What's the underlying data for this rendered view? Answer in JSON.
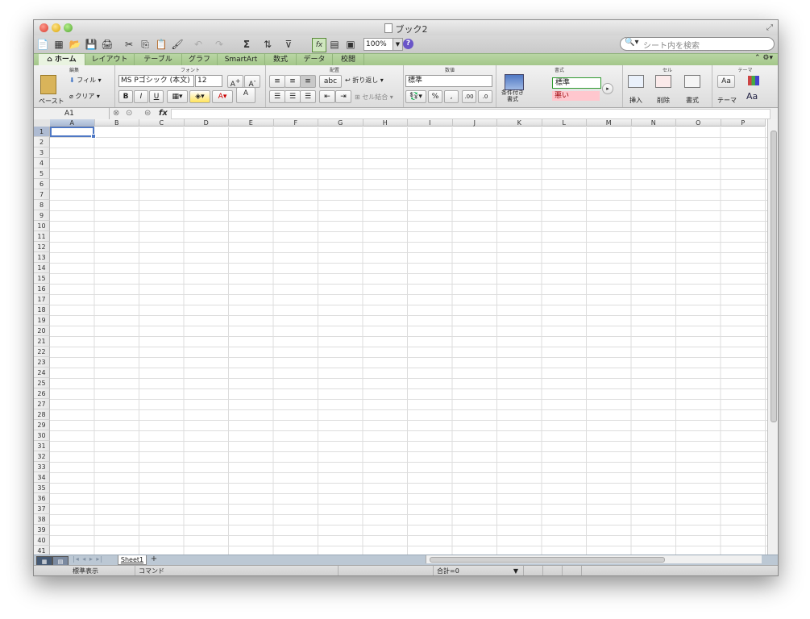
{
  "window": {
    "title": "ブック2"
  },
  "toolbar": {
    "zoom": "100%",
    "search_placeholder": "シート内を検索"
  },
  "tabs": [
    "ホーム",
    "レイアウト",
    "テーブル",
    "グラフ",
    "SmartArt",
    "数式",
    "データ",
    "校閲"
  ],
  "ribbon": {
    "groups": {
      "edit": "編集",
      "font": "フォント",
      "align": "配置",
      "number": "数値",
      "style": "書式",
      "cells": "セル",
      "theme": "テーマ"
    },
    "paste": "ペースト",
    "fill": "フィル",
    "clear": "クリア",
    "font_name": "MS Pゴシック (本文)",
    "font_size": "12",
    "bold": "B",
    "italic": "I",
    "underline": "U",
    "wrap": "折り返し",
    "merge": "セル結合",
    "abc": "abc",
    "number_format": "標準",
    "percent": "%",
    "conditional": "条件付き\n書式",
    "style_normal": "標準",
    "style_bad": "悪い",
    "insert": "挿入",
    "delete": "削除",
    "format": "書式",
    "theme": "テーマ",
    "theme_aa": "Aa"
  },
  "formula_bar": {
    "name_box": "A1",
    "fx": "fx"
  },
  "columns": [
    "A",
    "B",
    "C",
    "D",
    "E",
    "F",
    "G",
    "H",
    "I",
    "J",
    "K",
    "L",
    "M",
    "N",
    "O",
    "P"
  ],
  "rows": [
    "1",
    "2",
    "3",
    "4",
    "5",
    "6",
    "7",
    "8",
    "9",
    "10",
    "11",
    "12",
    "13",
    "14",
    "15",
    "16",
    "17",
    "18",
    "19",
    "20",
    "21",
    "22",
    "23",
    "24",
    "25",
    "26",
    "27",
    "28",
    "29",
    "30",
    "31",
    "32",
    "33",
    "34",
    "35",
    "36",
    "37",
    "38",
    "39",
    "40",
    "41"
  ],
  "sheet_tab": "Sheet1",
  "status": {
    "view": "標準表示",
    "mode": "コマンド",
    "sum": "合計=0"
  },
  "colors": {
    "ribbon_tab": "#a9c98f",
    "selection": "#4f78c4",
    "bad_style_bg": "#ffc7ce"
  }
}
